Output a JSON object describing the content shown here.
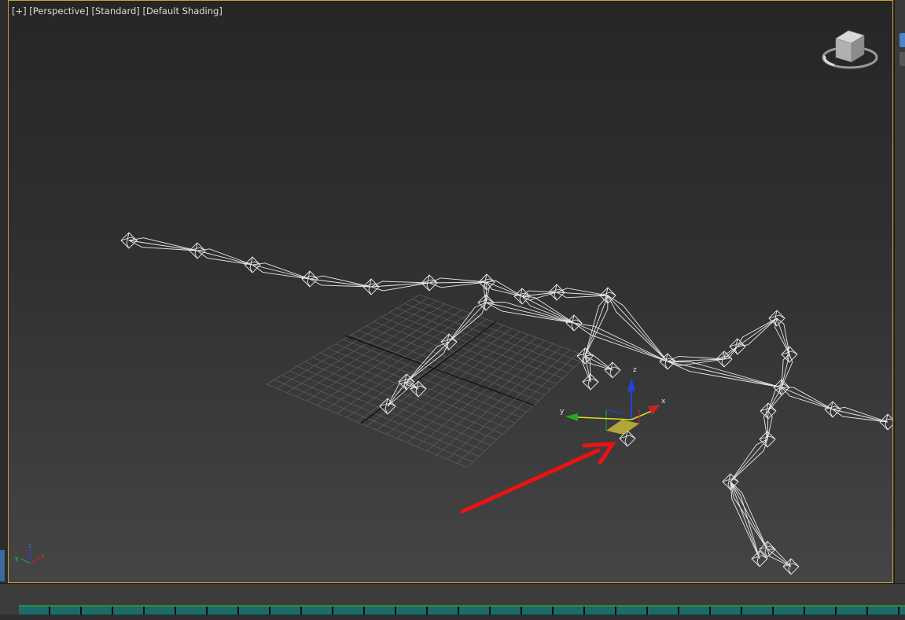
{
  "viewport": {
    "label_plus": "[+]",
    "label_view": "[Perspective]",
    "label_mode": "[Standard]",
    "label_shading": "[Default Shading]"
  },
  "gizmo": {
    "x": "x",
    "y": "y",
    "z": "z"
  },
  "axis_tripod": {
    "x": "x",
    "y": "y",
    "z": "z"
  },
  "colors": {
    "viewport_border": "#c8a230",
    "x_axis": "#cc2222",
    "y_axis": "#22aa22",
    "z_axis": "#2244dd",
    "annotation_arrow": "#ee1111",
    "wireframe": "#e8e8e8"
  },
  "icons": {
    "viewcube": "viewcube-icon",
    "transform_gizmo": "move-gizmo-icon",
    "axis_tripod": "axis-tripod-icon",
    "annotation_arrow": "red-arrow-icon"
  }
}
